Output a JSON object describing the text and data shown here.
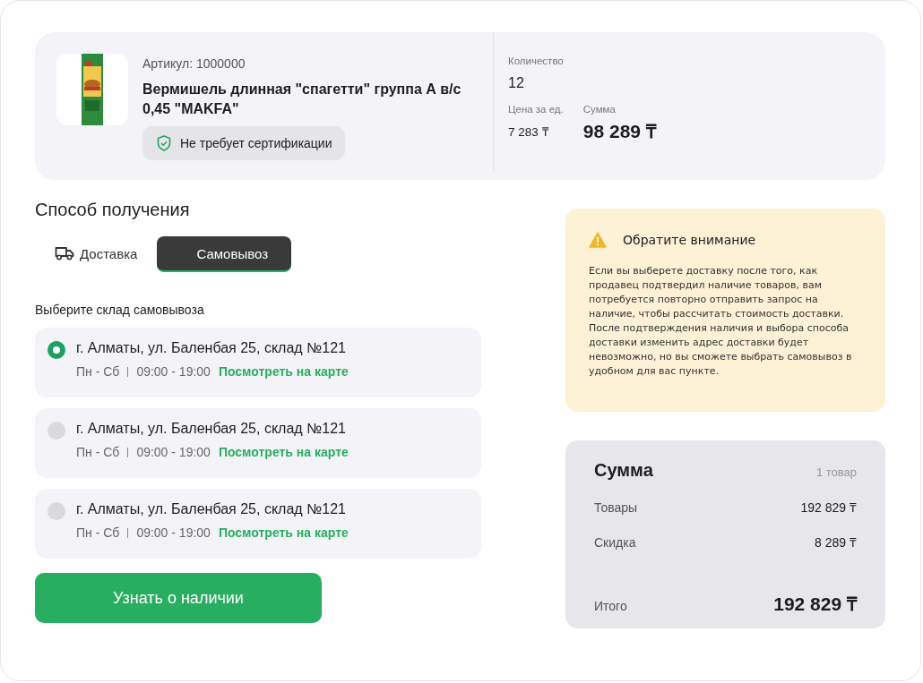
{
  "product": {
    "article": "Артикул: 1000000",
    "name": "Вермишель длинная \"спагетти\" группа А в/с 0,45 \"MAKFA\"",
    "badge": "Не требует сертификации",
    "quantity_label": "Количество",
    "quantity": "12",
    "unit_price_label": "Цена за ед.",
    "unit_price": "7 283 ₸",
    "sum_label": "Сумма",
    "sum": "98 289 ₸"
  },
  "delivery": {
    "title": "Способ получения",
    "tabs": [
      {
        "label": "Доставка",
        "kind": "delivery",
        "selected": false
      },
      {
        "label": "Самовывоз",
        "kind": "pickup",
        "selected": true
      }
    ],
    "warehouse_label": "Выберите склад самовывоза",
    "warehouses": [
      {
        "address": "г. Алматы, ул. Баленбая 25, склад №121",
        "days": "Пн - Сб",
        "hours": "09:00 - 19:00",
        "map_link": "Посмотреть на карте",
        "selected": true
      },
      {
        "address": "г. Алматы, ул. Баленбая 25, склад №121",
        "days": "Пн - Сб",
        "hours": "09:00 - 19:00",
        "map_link": "Посмотреть на карте",
        "selected": false
      },
      {
        "address": "г. Алматы, ул. Баленбая 25, склад №121",
        "days": "Пн - Сб",
        "hours": "09:00 - 19:00",
        "map_link": "Посмотреть на карте",
        "selected": false
      }
    ],
    "button": "Узнать о наличии"
  },
  "notice": {
    "title": "Обратите внимание",
    "text": "Если вы выберете доставку после того, как продавец подтвердил наличие товаров, вам потребуется повторно отправить запрос на наличие, чтобы рассчитать стоимость доставки. После подтверждения наличия и выбора способа доставки изменить адрес доставки будет невозможно, но вы сможете выбрать самовывоз в удобном для вас пункте."
  },
  "summary": {
    "title": "Сумма",
    "count": "1 товар",
    "rows": [
      {
        "label": "Товары",
        "value": "192 829 ₸"
      },
      {
        "label": "Скидка",
        "value": "8 289 ₸"
      }
    ],
    "total_label": "Итого",
    "total": "192 829 ₸"
  }
}
